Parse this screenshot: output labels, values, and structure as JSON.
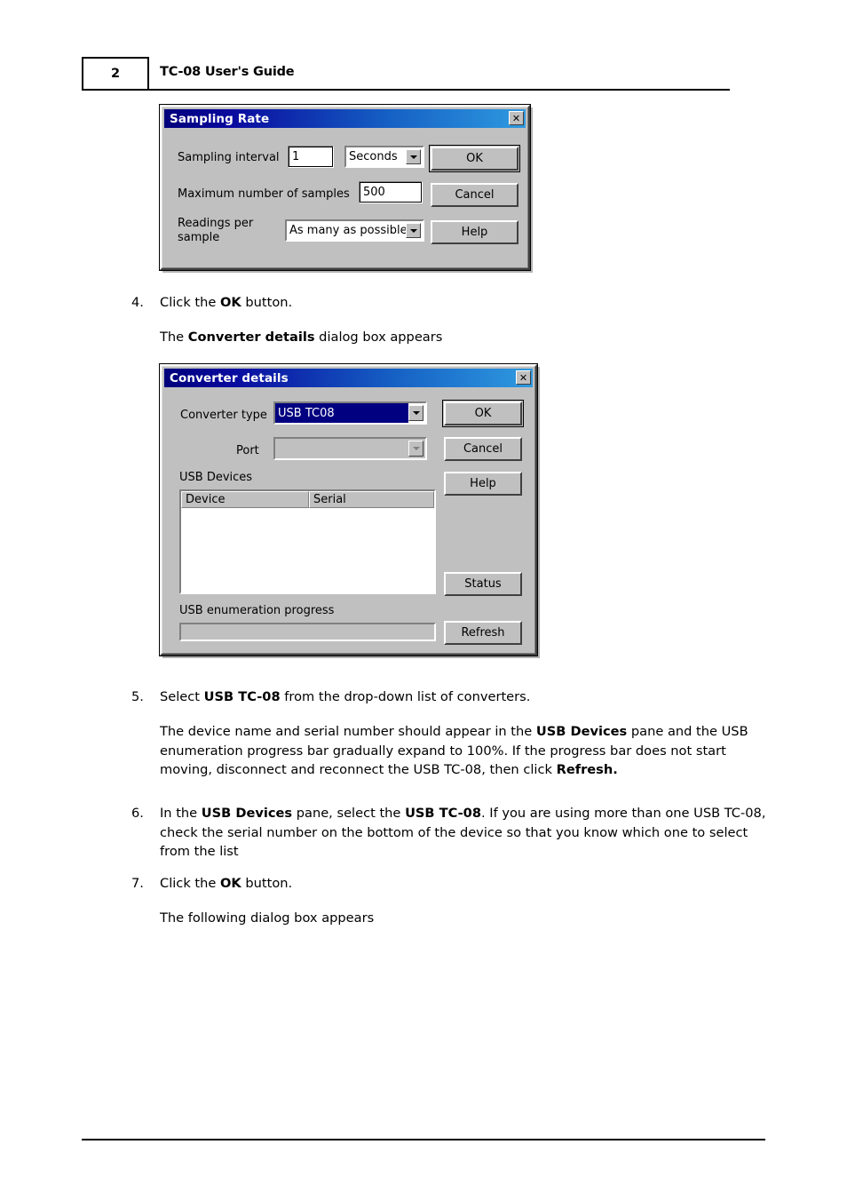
{
  "header": {
    "page_number": "2",
    "title": "TC-08 User's Guide"
  },
  "sampling_rate_dialog": {
    "title": "Sampling Rate",
    "close_icon": "close-icon",
    "fields": {
      "sampling_interval_label": "Sampling interval",
      "sampling_interval_value": "1",
      "sampling_interval_unit": "Seconds",
      "max_samples_label": "Maximum number of samples",
      "max_samples_value": "500",
      "readings_per_sample_label": "Readings per\nsample",
      "readings_per_sample_value": "As many as possible"
    },
    "buttons": {
      "ok": "OK",
      "cancel": "Cancel",
      "help": "Help"
    }
  },
  "step4": {
    "number": "4.",
    "text_before": "Click the ",
    "bold": "OK",
    "text_after": " button."
  },
  "para4": {
    "text_before": "The ",
    "bold": "Converter details",
    "text_after": " dialog box appears"
  },
  "converter_details_dialog": {
    "title": "Converter details",
    "close_icon": "close-icon",
    "fields": {
      "converter_type_label": "Converter type",
      "converter_type_value": "USB TC08",
      "port_label": "Port",
      "port_value": "",
      "usb_devices_label": "USB Devices",
      "progress_label": "USB enumeration progress",
      "progress_percent": 0
    },
    "list": {
      "columns": [
        "Device",
        "Serial"
      ],
      "rows": []
    },
    "buttons": {
      "ok": "OK",
      "cancel": "Cancel",
      "help": "Help",
      "status": "Status",
      "refresh": "Refresh"
    }
  },
  "step5": {
    "number": "5.",
    "p1_before": "Select ",
    "p1_bold": "USB TC-08",
    "p1_after": " from the drop-down list of converters."
  },
  "para5": {
    "a": "The device name and serial number should appear in the ",
    "b1": "USB Devices",
    "c": " pane and the USB enumeration progress bar gradually expand to 100%.  If the progress bar does not start moving, disconnect and reconnect the USB TC-08, then click ",
    "b2": "Refresh."
  },
  "step6": {
    "number": "6.",
    "a": "In the ",
    "b1": "USB Devices",
    "c": " pane, select the ",
    "b2": "USB TC-08",
    "d": ".  If you are using more than one USB TC-08, check the serial number on the bottom of the device so that you know which one to select from the list"
  },
  "step7": {
    "number": "7.",
    "text_before": "Click the ",
    "bold": "OK",
    "text_after": " button."
  },
  "para7": {
    "text": "The following dialog box appears"
  }
}
